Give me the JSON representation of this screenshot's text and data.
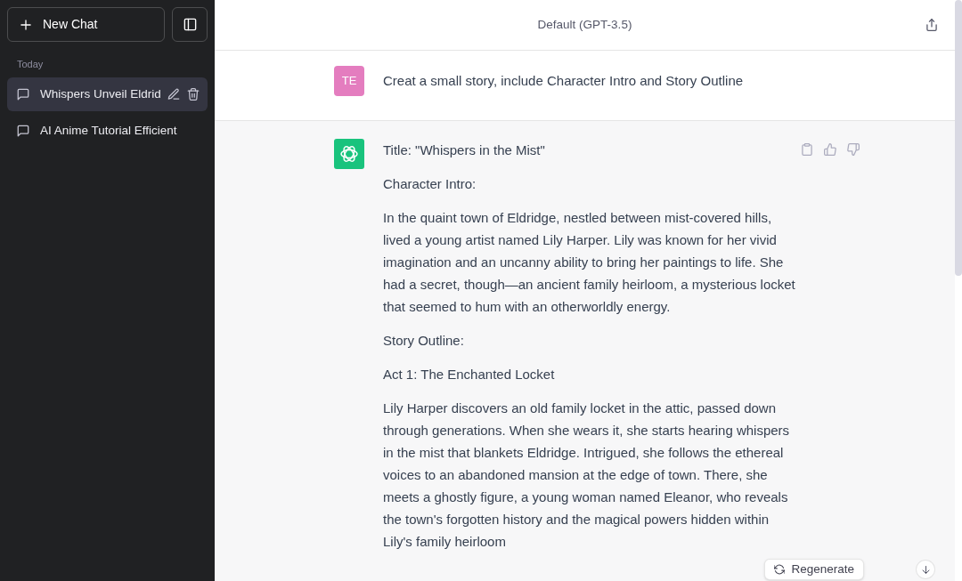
{
  "sidebar": {
    "new_chat_button": "New Chat",
    "section_label": "Today",
    "chats": [
      {
        "title": "Whispers Unveil Eldrid",
        "selected": true
      },
      {
        "title": "AI Anime Tutorial Efficient",
        "selected": false
      }
    ]
  },
  "header": {
    "model": "Default (GPT-3.5)"
  },
  "messages": [
    {
      "kind": "user",
      "avatar": "TE",
      "paragraphs": [
        "Creat a small story, include Character Intro and Story Outline"
      ]
    },
    {
      "kind": "assistant",
      "paragraphs": [
        "Title: \"Whispers in the Mist\"",
        "Character Intro:",
        "In the quaint town of Eldridge, nestled between mist-covered hills, lived a young artist named Lily Harper. Lily was known for her vivid imagination and an uncanny ability to bring her paintings to life. She had a secret, though—an ancient family heirloom, a mysterious locket that seemed to hum with an otherworldly energy.",
        "Story Outline:",
        "Act 1: The Enchanted Locket",
        "Lily Harper discovers an old family locket in the attic, passed down through generations. When she wears it, she starts hearing whispers in the mist that blankets Eldridge. Intrigued, she follows the ethereal voices to an abandoned mansion at the edge of town. There, she meets a ghostly figure, a young woman named Eleanor, who reveals the town's forgotten history and the magical powers hidden within Lily's family heirloom"
      ]
    }
  ],
  "regenerate_button": "Regenerate"
}
